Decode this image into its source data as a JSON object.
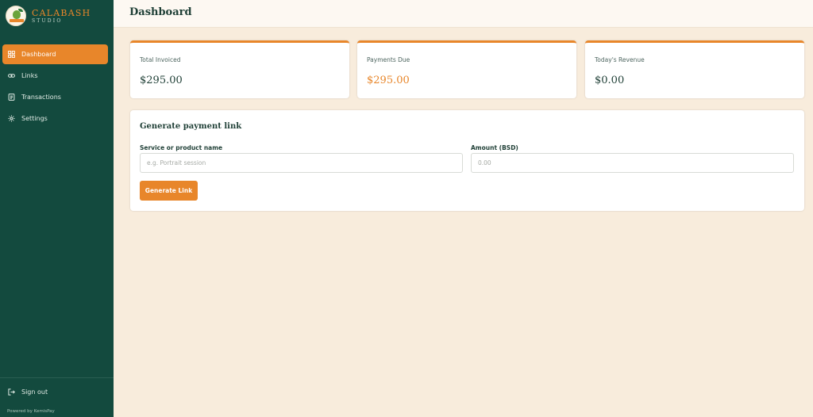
{
  "brand": {
    "name": "CALABASH",
    "subtitle": "STUDIO",
    "logo_icon": "calabash-logo-icon"
  },
  "sidebar": {
    "items": [
      {
        "label": "Dashboard",
        "icon": "grid-icon",
        "active": true
      },
      {
        "label": "Links",
        "icon": "link-icon",
        "active": false
      },
      {
        "label": "Transactions",
        "icon": "receipt-icon",
        "active": false
      },
      {
        "label": "Settings",
        "icon": "gear-icon",
        "active": false
      }
    ],
    "signout_label": "Sign out",
    "signout_icon": "sign-out-icon",
    "powered_by": "Powered by KemisPay"
  },
  "header": {
    "title": "Dashboard"
  },
  "stats": [
    {
      "label": "Total Invoiced",
      "value": "$295.00"
    },
    {
      "label": "Payments Due",
      "value": "$295.00"
    },
    {
      "label": "Today's Revenue",
      "value": "$0.00"
    }
  ],
  "payment_link_form": {
    "title": "Generate payment link",
    "service_label": "Service or product name",
    "service_placeholder": "e.g. Portrait session",
    "service_value": "",
    "amount_label": "Amount (BSD)",
    "amount_placeholder": "0.00",
    "amount_value": "",
    "submit_label": "Generate Link"
  },
  "colors": {
    "sidebar": "#134a3e",
    "accent": "#e8862a",
    "background": "#f8ecdc",
    "text": "#1f3f36"
  }
}
